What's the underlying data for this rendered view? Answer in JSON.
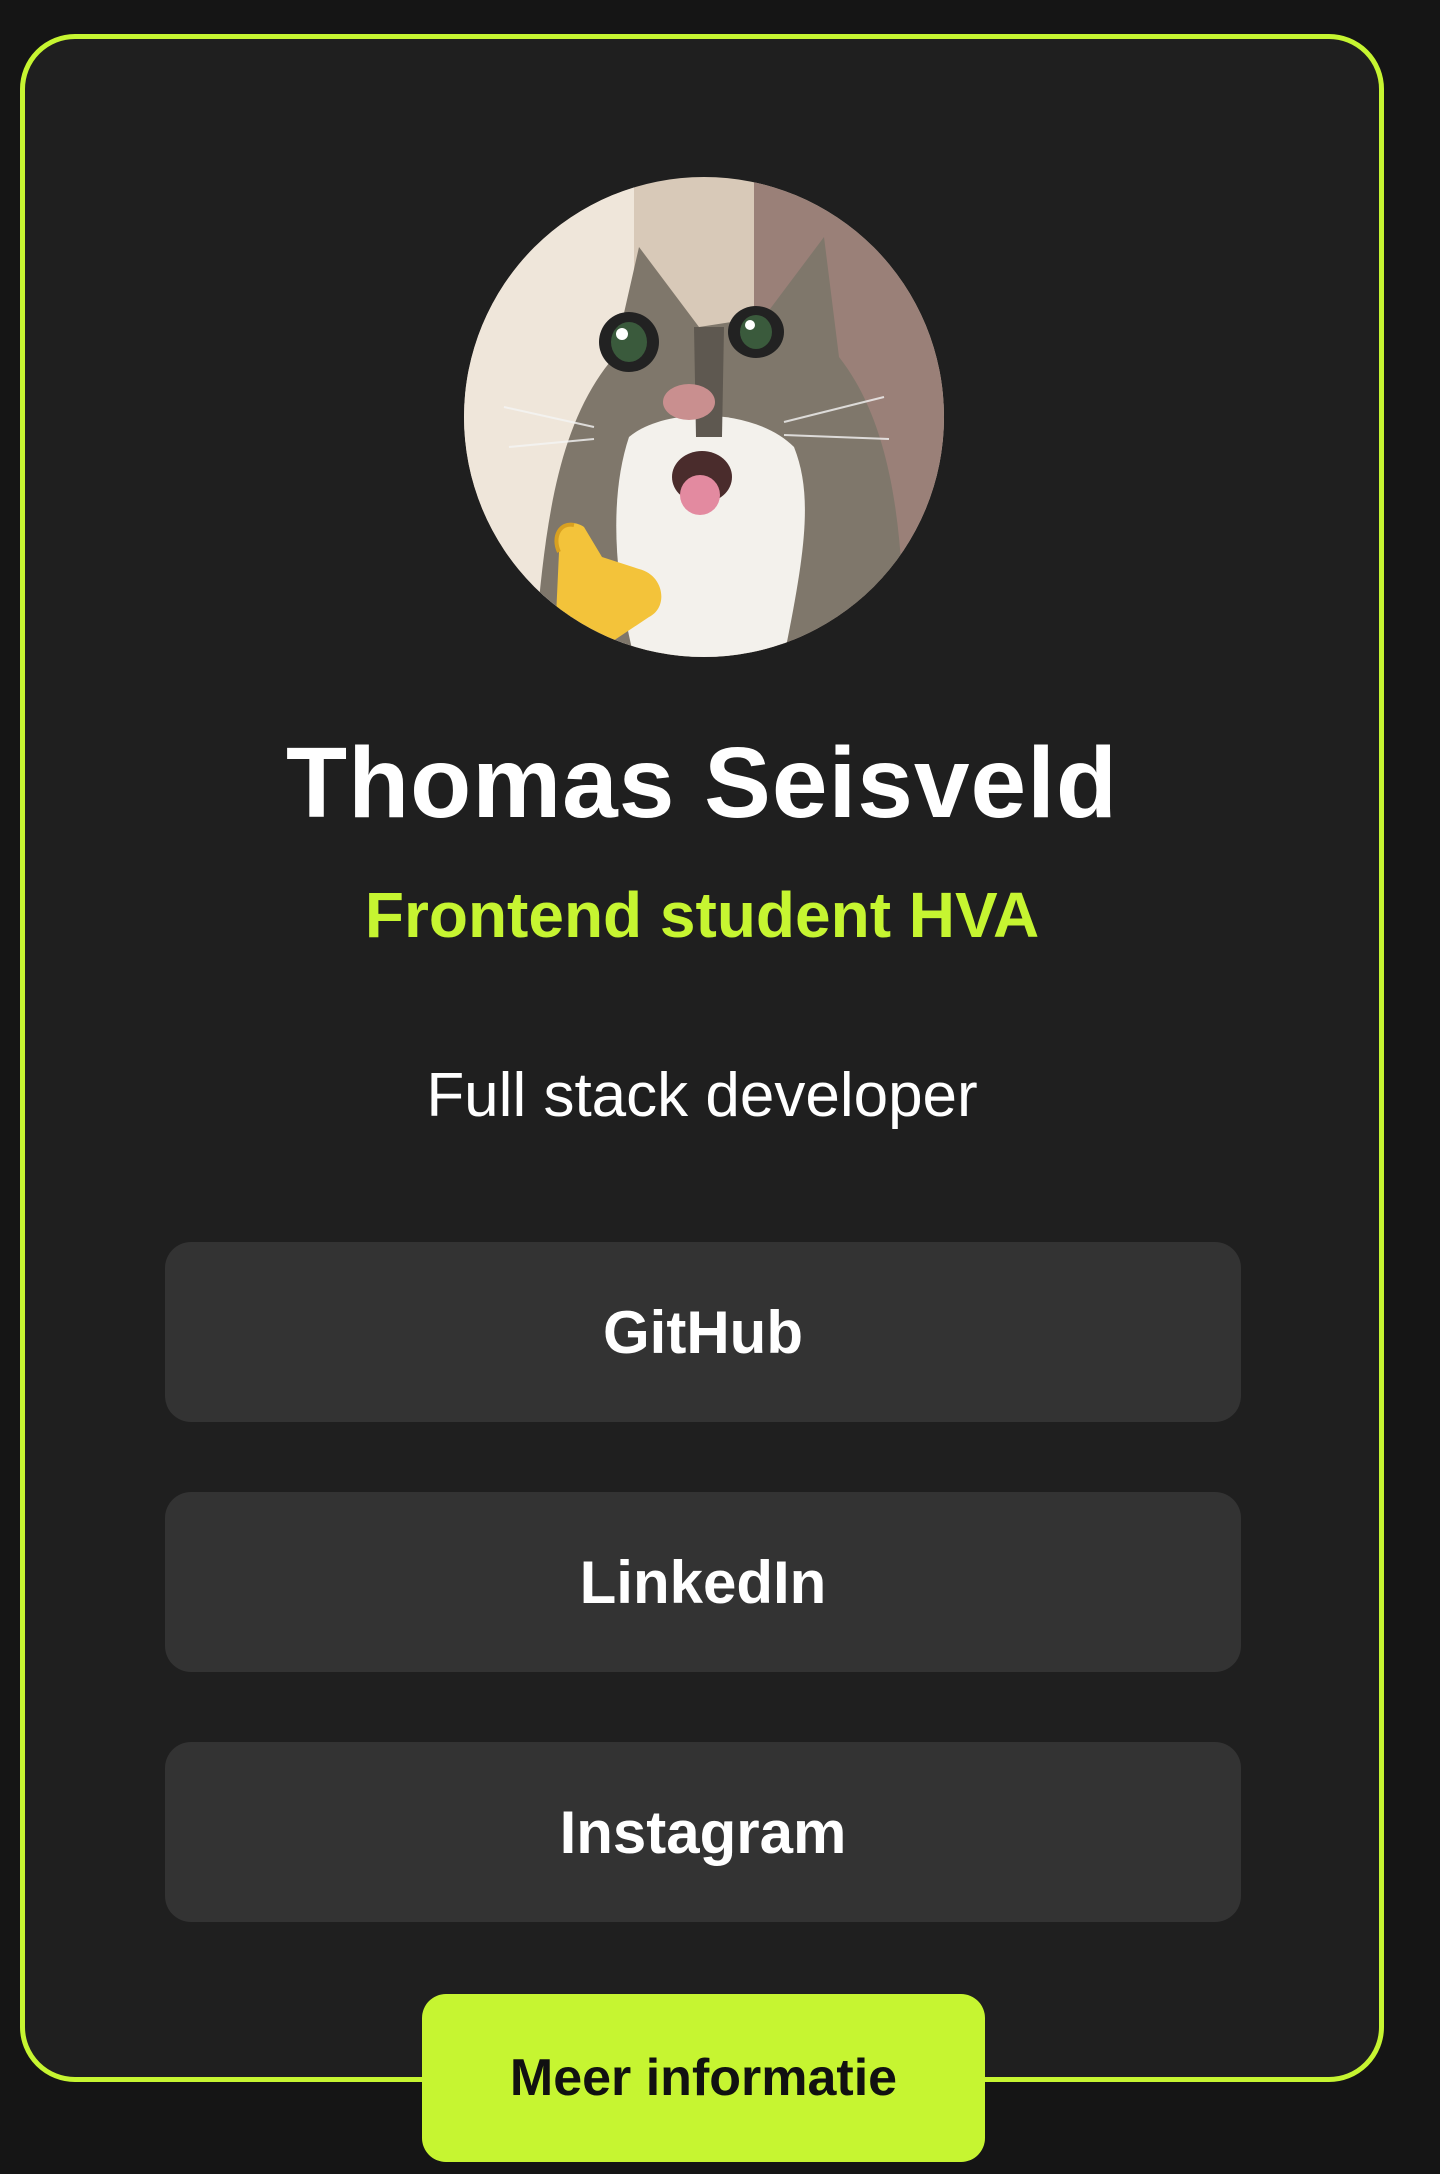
{
  "profile": {
    "name": "Thomas Seisveld",
    "subtitle": "Frontend student HVA",
    "tagline": "Full stack developer",
    "avatar_icon": "cat-avatar-icon"
  },
  "links": [
    {
      "label": "GitHub"
    },
    {
      "label": "LinkedIn"
    },
    {
      "label": "Instagram"
    }
  ],
  "more_button": {
    "label": "Meer informatie"
  },
  "colors": {
    "background": "#151515",
    "card": "#1f1f1f",
    "accent": "#c6f531",
    "button": "#333333",
    "text": "#ffffff"
  }
}
